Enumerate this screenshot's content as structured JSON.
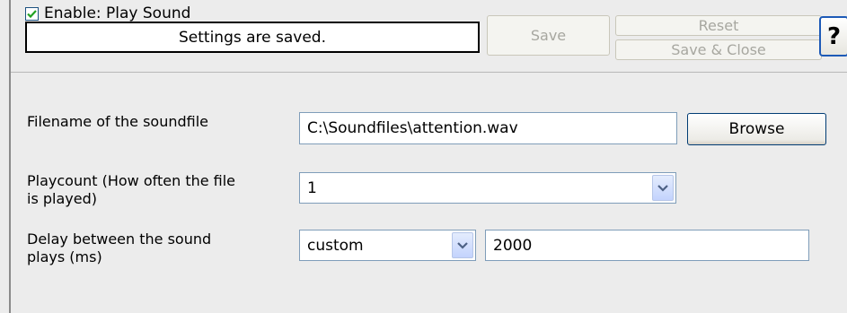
{
  "header": {
    "enable_label": "Enable: Play Sound",
    "enable_checked": true,
    "status_text": "Settings are saved.",
    "save_label": "Save",
    "reset_label": "Reset",
    "save_close_label": "Save & Close",
    "help_label": "?"
  },
  "form": {
    "filename": {
      "label": "Filename of the soundfile",
      "value": "C:\\Soundfiles\\attention.wav",
      "browse_label": "Browse"
    },
    "playcount": {
      "label_line1": "Playcount (How often the file",
      "label_line2": "is played)",
      "value": "1"
    },
    "delay": {
      "label_line1": "Delay between the sound",
      "label_line2": "plays (ms)",
      "mode_value": "custom",
      "ms_value": "2000"
    }
  },
  "colors": {
    "accent_border": "#7f9db9",
    "check_color": "#21a121",
    "help_border": "#1d5ab7"
  }
}
